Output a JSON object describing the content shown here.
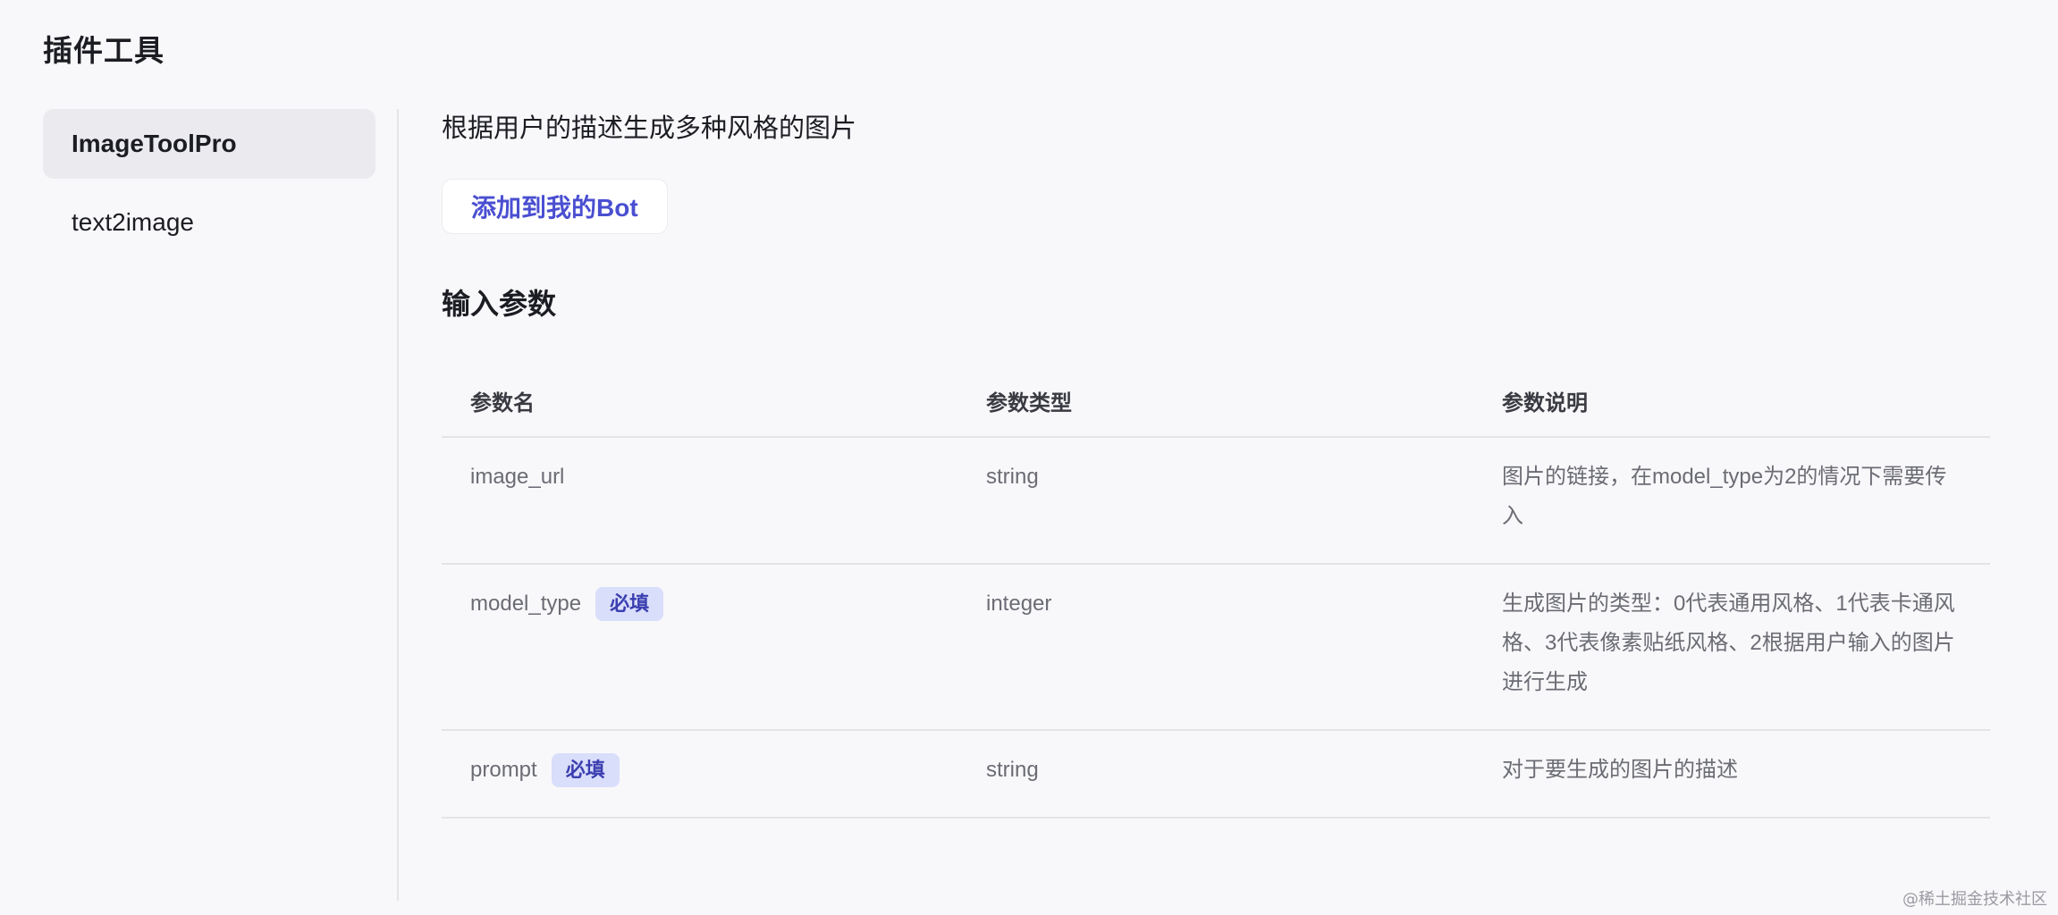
{
  "page": {
    "title": "插件工具"
  },
  "sidebar": {
    "items": [
      {
        "label": "ImageToolPro",
        "active": true
      },
      {
        "label": "text2image",
        "active": false
      }
    ]
  },
  "main": {
    "description": "根据用户的描述生成多种风格的图片",
    "add_button_label": "添加到我的Bot",
    "section_title": "输入参数",
    "table": {
      "headers": [
        "参数名",
        "参数类型",
        "参数说明"
      ],
      "rows": [
        {
          "name": "image_url",
          "required_label": "",
          "type": "string",
          "description": "图片的链接，在model_type为2的情况下需要传入"
        },
        {
          "name": "model_type",
          "required_label": "必填",
          "type": "integer",
          "description": "生成图片的类型：0代表通用风格、1代表卡通风格、3代表像素贴纸风格、2根据用户输入的图片进行生成"
        },
        {
          "name": "prompt",
          "required_label": "必填",
          "type": "string",
          "description": "对于要生成的图片的描述"
        }
      ]
    }
  },
  "watermark": "@稀土掘金技术社区",
  "colors": {
    "background": "#f8f8fa",
    "accent": "#4a4fd1",
    "badge_bg": "#d9defb"
  }
}
